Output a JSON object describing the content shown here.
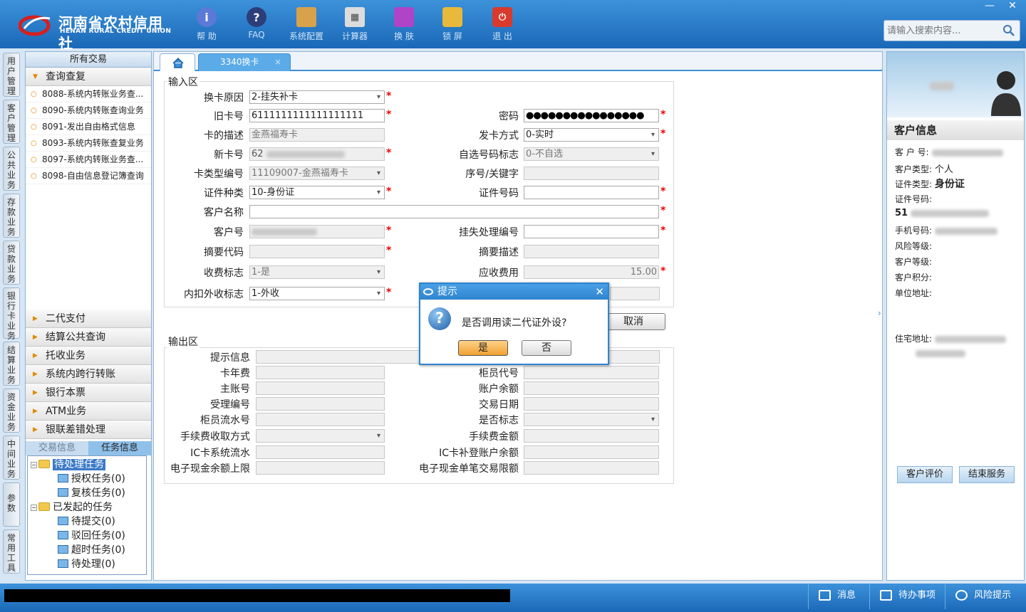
{
  "header": {
    "logo_cn": "河南省农村信用社",
    "logo_en": "HENAN RURAL CREDIT UNION",
    "tools": [
      "帮 助",
      "FAQ",
      "系统配置",
      "计算器",
      "换 肤",
      "锁 屏",
      "退 出"
    ],
    "search_placeholder": "请输入搜索内容...",
    "min_glyph": "—",
    "close_glyph": "✕"
  },
  "vtabs": [
    "用户管理",
    "客户管理",
    "公共业务",
    "存款业务",
    "贷款业务",
    "银行卡业务",
    "结算业务",
    "资金业务",
    "中间业务",
    "参数",
    "常用工具"
  ],
  "left_panel": {
    "title": "所有交易",
    "section_open": "查询查复",
    "items": [
      "8088-系统内转账业务查...",
      "8090-系统内转账查询业务",
      "8091-发出自由格式信息",
      "8093-系统内转账查复业务",
      "8097-系统内转账业务查...",
      "8098-自由信息登记簿查询"
    ],
    "sections": [
      "二代支付",
      "结算公共查询",
      "托收业务",
      "系统内跨行转账",
      "银行本票",
      "ATM业务",
      "银联差错处理"
    ],
    "task_tabs": [
      "交易信息",
      "任务信息"
    ],
    "tree": {
      "pending": "待处理任务",
      "auth": "授权任务(0)",
      "review": "复核任务(0)",
      "started": "已发起的任务",
      "submit": "待提交(0)",
      "rejected": "驳回任务(0)",
      "timeout": "超时任务(0)",
      "todo": "待处理(0)"
    }
  },
  "main": {
    "tab_label": "3340换卡",
    "tab_close": "×",
    "input_section": "输入区",
    "output_section": "输出区",
    "fields": {
      "reason": {
        "label": "换卡原因",
        "value": "2-挂失补卡"
      },
      "old_card": {
        "label": "旧卡号",
        "value": "6111111111111111111"
      },
      "password": {
        "label": "密码",
        "value": "●●●●●●●●●●●●●●●●"
      },
      "card_desc": {
        "label": "卡的描述",
        "value": "金燕福寿卡"
      },
      "issue_mode": {
        "label": "发卡方式",
        "value": "0-实时"
      },
      "new_card": {
        "label": "新卡号",
        "value": "62"
      },
      "self_no_flag": {
        "label": "自选号码标志",
        "value": "0-不自选"
      },
      "card_type": {
        "label": "卡类型编号",
        "value": "11109007-金燕福寿卡"
      },
      "seq_key": {
        "label": "序号/关键字",
        "value": ""
      },
      "id_type": {
        "label": "证件种类",
        "value": "10-身份证"
      },
      "id_no": {
        "label": "证件号码",
        "value": ""
      },
      "cust_name": {
        "label": "客户名称",
        "value": ""
      },
      "cust_no": {
        "label": "客户号",
        "value": ""
      },
      "loss_no": {
        "label": "挂失处理编号",
        "value": ""
      },
      "summary_code": {
        "label": "摘要代码",
        "value": ""
      },
      "summary_desc": {
        "label": "摘要描述",
        "value": ""
      },
      "fee_flag": {
        "label": "收费标志",
        "value": "1-是"
      },
      "fee_due": {
        "label": "应收费用",
        "value": "15.00"
      },
      "fee_inout": {
        "label": "内扣外收标志",
        "value": "1-外收"
      }
    },
    "cancel_label": "取消",
    "outputs": {
      "prompt": "提示信息",
      "card_fee": "卡年费",
      "teller_code": "柜员代号",
      "main_acct": "主账号",
      "balance": "账户余额",
      "accept_no": "受理编号",
      "txn_date": "交易日期",
      "teller_flow": "柜员流水号",
      "yes_no_flag": "是否标志",
      "fee_method": "手续费收取方式",
      "fee_amount": "手续费金额",
      "ic_flow": "IC卡系统流水",
      "ic_balance": "IC卡补登账户余额",
      "ecash_limit": "电子现金余额上限",
      "ecash_single": "电子现金单笔交易限额"
    }
  },
  "dialog": {
    "title": "提示",
    "message": "是否调用读二代证外设?",
    "yes": "是",
    "no": "否",
    "close": "✕"
  },
  "customer": {
    "title": "客户信息",
    "cust_no_label": "客 户 号:",
    "cust_type_label": "客户类型:",
    "cust_type_value": "个人",
    "id_type_label": "证件类型:",
    "id_type_value": "身份证",
    "id_no_label": "证件号码:",
    "id_no_prefix": "51",
    "phone_label": "手机号码:",
    "risk_label": "风险等级:",
    "level_label": "客户等级:",
    "points_label": "客户积分:",
    "work_addr_label": "单位地址:",
    "home_addr_label": "住宅地址:",
    "eval_button": "客户评价",
    "end_button": "结束服务"
  },
  "statusbar": {
    "messages": "消息",
    "todo": "待办事项",
    "risk": "风险提示"
  },
  "colors": {
    "header_blue": "#1a68b8",
    "accent_blue": "#3d8fd6",
    "required_red": "#e00000",
    "yes_button_orange": "#f0a030"
  }
}
